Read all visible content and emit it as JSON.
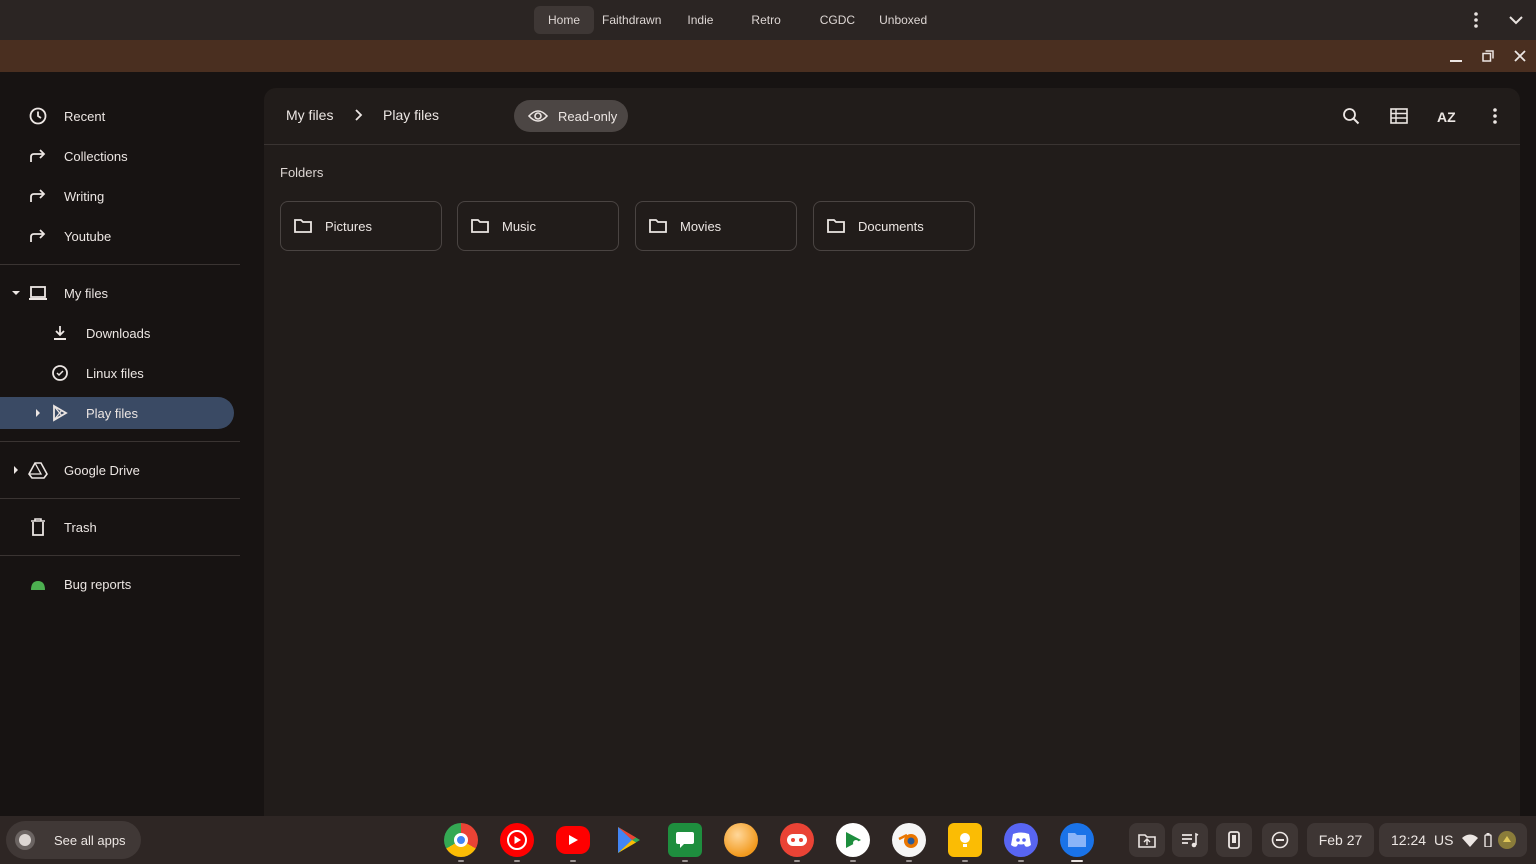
{
  "desks": {
    "tabs": [
      "Home",
      "Faithdrawn",
      "Indie",
      "Retro",
      "CGDC",
      "Unboxed"
    ],
    "active": "Home",
    "more_icon": "more-vert-icon",
    "expand_icon": "chevron-down-icon"
  },
  "window": {
    "controls": [
      "minimize-icon",
      "restore-icon",
      "close-icon"
    ]
  },
  "sidebar": {
    "shortcuts": [
      {
        "label": "Recent",
        "icon": "clock-icon"
      },
      {
        "label": "Collections",
        "icon": "shortcut-arrow-icon"
      },
      {
        "label": "Writing",
        "icon": "shortcut-arrow-icon"
      },
      {
        "label": "Youtube",
        "icon": "shortcut-arrow-icon"
      }
    ],
    "my_files": {
      "label": "My files",
      "icon": "laptop-icon"
    },
    "children": [
      {
        "label": "Downloads",
        "icon": "download-icon"
      },
      {
        "label": "Linux files",
        "icon": "linux-icon"
      },
      {
        "label": "Play files",
        "icon": "play-store-icon",
        "selected": true
      }
    ],
    "drive": {
      "label": "Google Drive",
      "icon": "drive-icon"
    },
    "trash": {
      "label": "Trash",
      "icon": "trash-icon"
    },
    "bug": {
      "label": "Bug reports",
      "icon": "android-icon"
    }
  },
  "toolbar": {
    "breadcrumb": [
      "My files",
      "Play files"
    ],
    "readonly_label": "Read-only",
    "buttons": [
      "search-icon",
      "list-view-icon",
      "sort-az-icon",
      "more-vert-icon"
    ]
  },
  "content": {
    "section_title": "Folders",
    "folders": [
      "Pictures",
      "Music",
      "Movies",
      "Documents"
    ]
  },
  "shelf": {
    "launcher_label": "See all apps",
    "apps": [
      "chrome",
      "youtube-music",
      "youtube",
      "play-store",
      "messages",
      "orange-app",
      "game-controller",
      "play-games",
      "blender",
      "keep",
      "discord",
      "files"
    ],
    "date": "Feb 27",
    "time": "12:24",
    "locale": "US"
  },
  "colors": {
    "background": "#171312",
    "panel": "#211c1a",
    "selected": "#3a4a64",
    "frame": "#4a2f20"
  }
}
